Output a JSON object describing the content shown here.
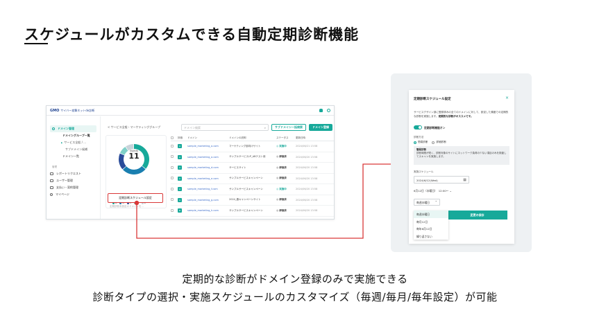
{
  "slide": {
    "title": "スケジュールがカスタムできる自動定期診断機能",
    "caption_line1": "定期的な診断がドメイン登録のみで実施できる",
    "caption_line2": "診断タイプの選択・実施スケジュールのカスタマイズ（毎週/毎月/毎年設定）が可能"
  },
  "colors": {
    "accent": "#17a99a",
    "highlight": "#d93737",
    "link": "#3a6bc9"
  },
  "app": {
    "logo": "GMO",
    "logo_sub": "サイバー攻撃ネットde診断",
    "sidebar": {
      "items": [
        {
          "label": "ドメイン管理",
          "active": true,
          "icon": "globe-icon"
        },
        {
          "label": "ドメイングループ一覧",
          "level": 1
        },
        {
          "label": "サービス全般 / ...",
          "level": 2,
          "current": true
        },
        {
          "label": "サブドメイン候補",
          "level": 2
        },
        {
          "label": "ドメイン一覧",
          "level": 2
        }
      ],
      "section": "管理",
      "items2": [
        {
          "label": "レポートリクエスト",
          "icon": "report-icon"
        },
        {
          "label": "ユーザー管理",
          "icon": "users-icon"
        },
        {
          "label": "支払い・契約管理",
          "icon": "billing-icon"
        },
        {
          "label": "マイページ",
          "icon": "mypage-icon"
        }
      ]
    },
    "breadcrumb": "サービス全般・マーケティンググループ",
    "search_placeholder": "ドメイン検索",
    "btn_subdomain": "サブドメイン一括検索",
    "btn_add_domain": "ドメイン登録",
    "donut": {
      "label": "登録件数",
      "value": "11",
      "segments": [
        {
          "grade": "A",
          "value": 4,
          "color": "#17a99a"
        },
        {
          "grade": "B",
          "value": 3,
          "color": "#1a7fb0"
        },
        {
          "grade": "C",
          "value": 2,
          "color": "#2a4c9a"
        },
        {
          "grade": "D",
          "value": 1,
          "color": "#7fd0c8"
        },
        {
          "grade": "E",
          "value": 1,
          "color": "#c9d3da"
        }
      ],
      "legend": [
        "A",
        "B",
        "C",
        "D",
        "E"
      ]
    },
    "schedule_button": "定期診断スケジュール設定",
    "schedule_note": "定期診断未設定のドメインを...",
    "table": {
      "headers": [
        "評価",
        "ドメイン",
        "ドメインの説明",
        "ステータス",
        "更新日時"
      ],
      "rows": [
        {
          "grade": "A",
          "domain": "sample_marketing_a.com",
          "desc": "マーケティング部向けサイト",
          "status": "実施中",
          "status_ok": true,
          "date": "2024/06/21 13:58"
        },
        {
          "grade": "A",
          "domain": "sample_marketing_a.com",
          "desc": "サンプルサービスLP_ABテスト用",
          "status": "評価済",
          "status_ok": false,
          "date": "2024/06/20 13:58"
        },
        {
          "grade": "A",
          "domain": "sample_marketing_d.com",
          "desc": "サービスサイト",
          "status": "評価済",
          "status_ok": false,
          "date": "2024/06/20 13:58"
        },
        {
          "grade": "A",
          "domain": "sample_marketing_e.com",
          "desc": "サンプルサービスキャンペーン",
          "status": "評価済",
          "status_ok": false,
          "date": "2024/06/20 13:58"
        },
        {
          "grade": "A",
          "domain": "sample_marketing_f.com",
          "desc": "サンプルサービスキャンペーン",
          "status": "実施中",
          "status_ok": true,
          "date": "2024/06/20 13:58"
        },
        {
          "grade": "A",
          "domain": "sample_marketing_g.com",
          "desc": "2024_春キャンペーンサイト",
          "status": "評価済",
          "status_ok": false,
          "date": "2024/06/20 13:58"
        },
        {
          "grade": "B",
          "domain": "sample_marketing_h.com",
          "desc": "サンプルサービスキャンペーン",
          "status": "評価済",
          "status_ok": false,
          "date": "2024/06/20 13:58"
        }
      ]
    }
  },
  "panel": {
    "title": "定期診断スケジュール設定",
    "close": "×",
    "description": "サービスデザイン部に登録済みの全てのドメインに対して、設定した頻度での定期的な診断を実施します。",
    "description_bold": "定期的な診断がオススメです。",
    "toggle_label": "定期診断機能オン",
    "method_label": "診断方法",
    "radio_simple": "簡易診断",
    "radio_detail": "詳細診断",
    "info_title": "簡易診断",
    "info_text": "診断時間が短く、診断対象のサイトにネットワーク負荷の少ない項目のみを検査してスキャンを実施します。",
    "schedule_label": "実施スケジュール",
    "date_value": "2024/6/12(Wed)",
    "time_text": "6月12日（水曜日）　12:00～ ⌄",
    "repeat_value": "毎週水曜日",
    "change_button": "変更の保存",
    "dropdown_options": [
      "毎週水曜日",
      "毎月12日",
      "毎年6月12日",
      "繰り返さない"
    ]
  }
}
